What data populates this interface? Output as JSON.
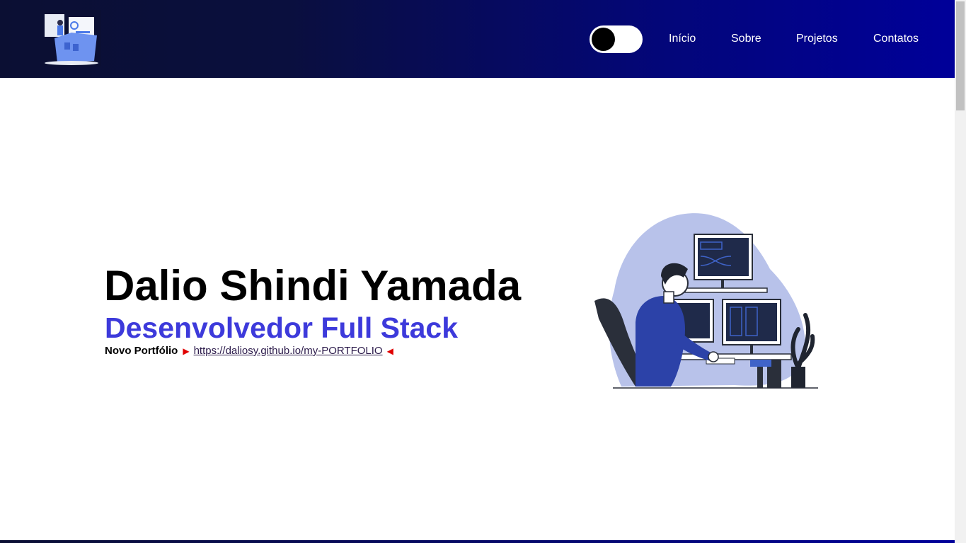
{
  "header": {
    "nav": [
      {
        "label": "Início"
      },
      {
        "label": "Sobre"
      },
      {
        "label": "Projetos"
      },
      {
        "label": "Contatos"
      }
    ],
    "theme_toggle": {
      "state": "dark-knob-left"
    }
  },
  "hero": {
    "name": "Dalio Shindi Yamada",
    "role": "Desenvolvedor Full Stack",
    "portfolio_label": "Novo Portfólio",
    "arrow_right": "▶",
    "portfolio_url": "https://daliosy.github.io/my-PORTFOLIO",
    "arrow_left": "◀"
  },
  "colors": {
    "header_start": "#0b0f33",
    "header_end": "#000099",
    "role_text": "#3d3adb",
    "arrow": "#e00000",
    "blob": "#b8c2ea"
  },
  "icons": {
    "logo": "developer-folder-logo",
    "illustration": "developer-at-computer-illustration"
  }
}
